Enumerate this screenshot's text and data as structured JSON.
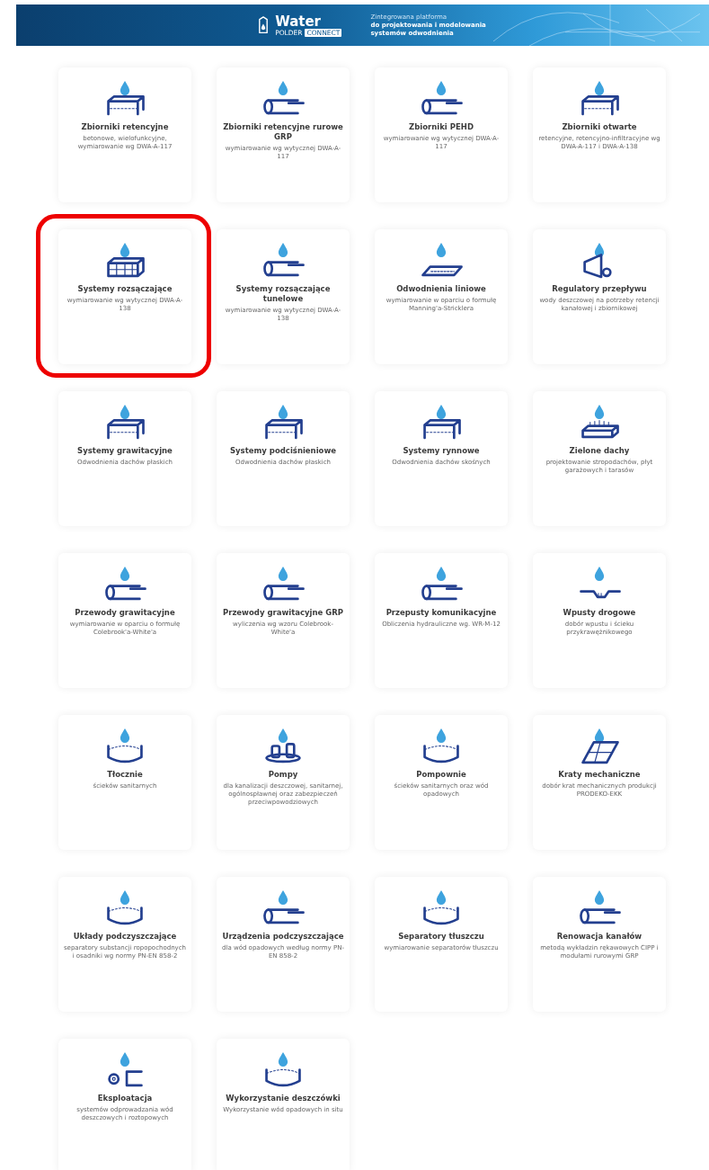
{
  "banner": {
    "logo": {
      "name": "Water",
      "sub": "POLDER",
      "badge": "CONNECT"
    },
    "tagline": [
      "Zintegrowana platforma",
      "do projektowania i modelowania",
      "systemów odwodnienia"
    ]
  },
  "items": [
    {
      "title": "Zbiorniki retencyjne",
      "desc": "betonowe, wielofunkcyjne, wymiarowanie wg DWA-A-117",
      "highlighted": false
    },
    {
      "title": "Zbiorniki retencyjne rurowe GRP",
      "desc": "wymiarowanie wg wytycznej DWA-A-117",
      "highlighted": false
    },
    {
      "title": "Zbiorniki PEHD",
      "desc": "wymiarowanie wg wytycznej DWA-A-117",
      "highlighted": false
    },
    {
      "title": "Zbiorniki otwarte",
      "desc": "retencyjne, retencyjno-infiltracyjne wg DWA-A-117 i DWA-A-138",
      "highlighted": false
    },
    {
      "title": "Systemy rozsączające",
      "desc": "wymiarowanie wg wytycznej DWA-A-138",
      "highlighted": true
    },
    {
      "title": "Systemy rozsączające tunelowe",
      "desc": "wymiarowanie wg wytycznej DWA-A-138",
      "highlighted": false
    },
    {
      "title": "Odwodnienia liniowe",
      "desc": "wymiarowanie w oparciu o formułę Manning'a-Stricklera",
      "highlighted": false
    },
    {
      "title": "Regulatory przepływu",
      "desc": "wody deszczowej na potrzeby retencji kanałowej i zbiornikowej",
      "highlighted": false
    },
    {
      "title": "Systemy grawitacyjne",
      "desc": "Odwodnienia dachów płaskich",
      "highlighted": false
    },
    {
      "title": "Systemy podciśnieniowe",
      "desc": "Odwodnienia dachów płaskich",
      "highlighted": false
    },
    {
      "title": "Systemy rynnowe",
      "desc": "Odwodnienia dachów skośnych",
      "highlighted": false
    },
    {
      "title": "Zielone dachy",
      "desc": "projektowanie stropodachów, płyt garażowych i tarasów",
      "highlighted": false
    },
    {
      "title": "Przewody grawitacyjne",
      "desc": "wymiarowanie w oparciu o formułę Colebrook'a-White'a",
      "highlighted": false
    },
    {
      "title": "Przewody grawitacyjne GRP",
      "desc": "wyliczenia wg wzoru Colebrook-White'a",
      "highlighted": false
    },
    {
      "title": "Przepusty komunikacyjne",
      "desc": "Obliczenia hydrauliczne wg. WR-M-12",
      "highlighted": false
    },
    {
      "title": "Wpusty drogowe",
      "desc": "dobór wpustu i ścieku przykrawężnikowego",
      "highlighted": false
    },
    {
      "title": "Tłocznie",
      "desc": "ścieków sanitarnych",
      "highlighted": false
    },
    {
      "title": "Pompy",
      "desc": "dla kanalizacji deszczowej, sanitarnej, ogólnospławnej oraz zabezpieczeń przeciwpowodziowych",
      "highlighted": false
    },
    {
      "title": "Pompownie",
      "desc": "ścieków sanitarnych oraz wód opadowych",
      "highlighted": false
    },
    {
      "title": "Kraty mechaniczne",
      "desc": "dobór krat mechanicznych produkcji PRODEKO-EKK",
      "highlighted": false
    },
    {
      "title": "Układy podczyszczające",
      "desc": "separatory substancji ropopochodnych i osadniki wg normy PN-EN 858-2",
      "highlighted": false
    },
    {
      "title": "Urządzenia podczyszczające",
      "desc": "dla wód opadowych według normy PN-EN 858-2",
      "highlighted": false
    },
    {
      "title": "Separatory tłuszczu",
      "desc": "wymiarowanie separatorów tłuszczu",
      "highlighted": false
    },
    {
      "title": "Renowacja kanałów",
      "desc": "metodą wykładzin rękawowych CIPP i modułami rurowymi GRP",
      "highlighted": false
    },
    {
      "title": "Eksploatacja",
      "desc": "systemów odprowadzania wód deszczowych i roztopowych",
      "highlighted": false
    },
    {
      "title": "Wykorzystanie deszczówki",
      "desc": "Wykorzystanie wód opadowych in situ",
      "highlighted": false
    }
  ]
}
